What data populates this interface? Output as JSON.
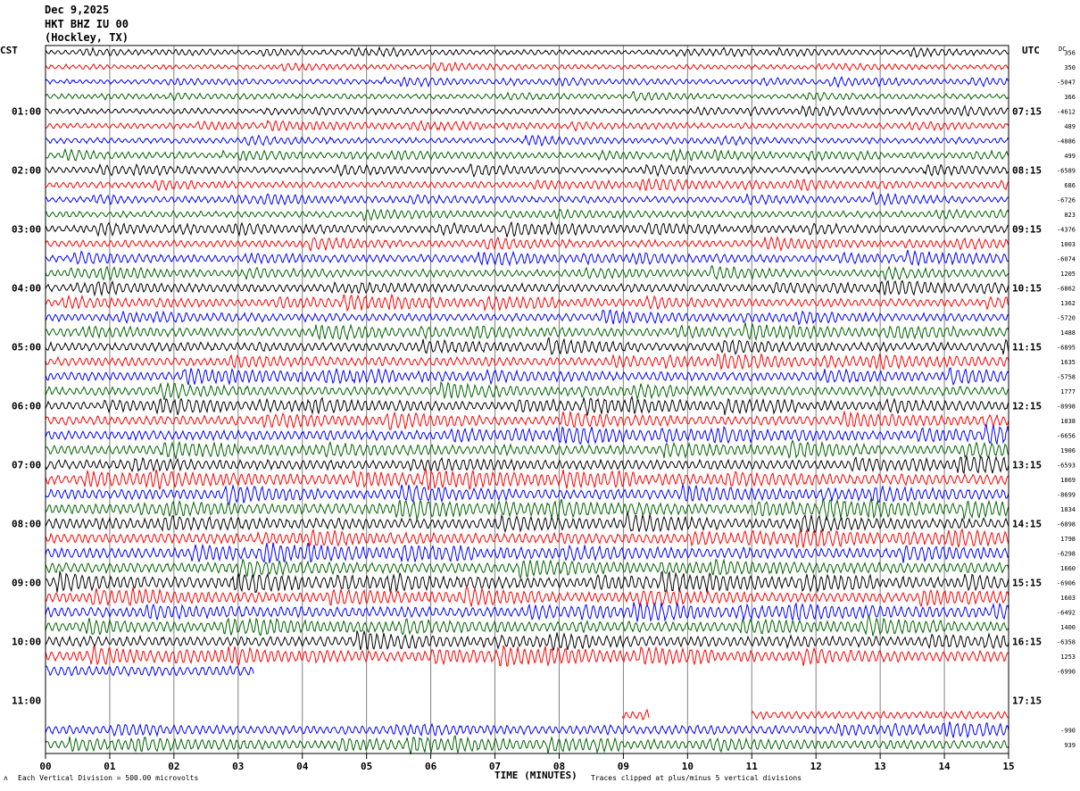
{
  "header": {
    "date": "Dec 9,2025",
    "station": "HKT BHZ IU 00",
    "location": "(Hockley, TX)"
  },
  "labels": {
    "left_tz": "CST",
    "right_tz": "UTC",
    "dc": "DC",
    "xlabel": "TIME (MINUTES)"
  },
  "footer": {
    "division": "Each Vertical Division =  500.00 microvolts",
    "clip": "Traces clipped at plus/minus 5 vertical divisions"
  },
  "colors": {
    "sequence": [
      "#000000",
      "#ff0000",
      "#0000ff",
      "#006400"
    ],
    "grid": "#808080"
  },
  "chart_data": {
    "type": "line",
    "title": "",
    "xlabel": "TIME (MINUTES)",
    "xlim": [
      0,
      15
    ],
    "x_ticks": [
      "00",
      "01",
      "02",
      "03",
      "04",
      "05",
      "06",
      "07",
      "08",
      "09",
      "10",
      "11",
      "12",
      "13",
      "14",
      "15"
    ],
    "minutes_per_trace": 15,
    "trace_count": 48,
    "left_hour_labels": [
      "01:00",
      "02:00",
      "03:00",
      "04:00",
      "05:00",
      "06:00",
      "07:00",
      "08:00",
      "09:00",
      "10:00",
      "11:00"
    ],
    "right_hour_labels": [
      "07:15",
      "08:15",
      "09:15",
      "10:15",
      "11:15",
      "12:15",
      "13:15",
      "14:15",
      "15:15",
      "16:15",
      "17:15"
    ],
    "dc_offsets": [
      "356",
      "350",
      "-5047",
      "366",
      "-4612",
      "489",
      "-4886",
      "499",
      "-6589",
      "686",
      "-6726",
      "823",
      "-4376",
      "1003",
      "-6074",
      "1205",
      "-6862",
      "1362",
      "-5720",
      "1488",
      "-6895",
      "1635",
      "-5758",
      "1777",
      "-8998",
      "1838",
      "-6656",
      "1906",
      "-6593",
      "1869",
      "-8699",
      "1834",
      "-6898",
      "1798",
      "-6298",
      "1660",
      "-6906",
      "1603",
      "-6492",
      "1400",
      "-6358",
      "1253",
      "-6990",
      "",
      "",
      "",
      "-990",
      "939"
    ],
    "traces": [
      {
        "index": 0,
        "color": "#000000",
        "amplitude": 0.6
      },
      {
        "index": 1,
        "color": "#ff0000",
        "amplitude": 0.6
      },
      {
        "index": 2,
        "color": "#0000ff",
        "amplitude": 0.6
      },
      {
        "index": 3,
        "color": "#006400",
        "amplitude": 0.6
      },
      {
        "index": 4,
        "color": "#000000",
        "amplitude": 0.7
      },
      {
        "index": 5,
        "color": "#ff0000",
        "amplitude": 0.7
      },
      {
        "index": 6,
        "color": "#0000ff",
        "amplitude": 0.7
      },
      {
        "index": 7,
        "color": "#006400",
        "amplitude": 0.7
      },
      {
        "index": 8,
        "color": "#000000",
        "amplitude": 0.8
      },
      {
        "index": 9,
        "color": "#ff0000",
        "amplitude": 0.8
      },
      {
        "index": 10,
        "color": "#0000ff",
        "amplitude": 0.8
      },
      {
        "index": 11,
        "color": "#006400",
        "amplitude": 0.8
      },
      {
        "index": 12,
        "color": "#000000",
        "amplitude": 0.9
      },
      {
        "index": 13,
        "color": "#ff0000",
        "amplitude": 0.9
      },
      {
        "index": 14,
        "color": "#0000ff",
        "amplitude": 0.9
      },
      {
        "index": 15,
        "color": "#006400",
        "amplitude": 0.9
      },
      {
        "index": 16,
        "color": "#000000",
        "amplitude": 1.0
      },
      {
        "index": 17,
        "color": "#ff0000",
        "amplitude": 1.0
      },
      {
        "index": 18,
        "color": "#0000ff",
        "amplitude": 1.0
      },
      {
        "index": 19,
        "color": "#006400",
        "amplitude": 1.0
      },
      {
        "index": 20,
        "color": "#000000",
        "amplitude": 1.1
      },
      {
        "index": 21,
        "color": "#ff0000",
        "amplitude": 1.1
      },
      {
        "index": 22,
        "color": "#0000ff",
        "amplitude": 1.1
      },
      {
        "index": 23,
        "color": "#006400",
        "amplitude": 1.1
      },
      {
        "index": 24,
        "color": "#000000",
        "amplitude": 1.1
      },
      {
        "index": 25,
        "color": "#ff0000",
        "amplitude": 1.2
      },
      {
        "index": 26,
        "color": "#0000ff",
        "amplitude": 1.2
      },
      {
        "index": 27,
        "color": "#006400",
        "amplitude": 1.2
      },
      {
        "index": 28,
        "color": "#000000",
        "amplitude": 1.2
      },
      {
        "index": 29,
        "color": "#ff0000",
        "amplitude": 1.3
      },
      {
        "index": 30,
        "color": "#0000ff",
        "amplitude": 1.3
      },
      {
        "index": 31,
        "color": "#006400",
        "amplitude": 1.3
      },
      {
        "index": 32,
        "color": "#000000",
        "amplitude": 1.3
      },
      {
        "index": 33,
        "color": "#ff0000",
        "amplitude": 1.3
      },
      {
        "index": 34,
        "color": "#0000ff",
        "amplitude": 1.3
      },
      {
        "index": 35,
        "color": "#006400",
        "amplitude": 1.3
      },
      {
        "index": 36,
        "color": "#000000",
        "amplitude": 1.3
      },
      {
        "index": 37,
        "color": "#ff0000",
        "amplitude": 1.3
      },
      {
        "index": 38,
        "color": "#0000ff",
        "amplitude": 1.3
      },
      {
        "index": 39,
        "color": "#006400",
        "amplitude": 1.3
      },
      {
        "index": 40,
        "color": "#000000",
        "amplitude": 1.3
      },
      {
        "index": 41,
        "color": "#ff0000",
        "amplitude": 1.3
      },
      {
        "index": 42,
        "color": "#0000ff",
        "amplitude": 1.3,
        "x_end": 3.25
      },
      {
        "index": 43,
        "color": "#006400",
        "amplitude": 0,
        "empty": true
      },
      {
        "index": 44,
        "color": "#000000",
        "amplitude": 0,
        "empty": true
      },
      {
        "index": 45,
        "color": "#ff0000",
        "amplitude": 1.0,
        "segments": [
          [
            8.98,
            9.4
          ],
          [
            11.0,
            15.0
          ]
        ]
      },
      {
        "index": 46,
        "color": "#0000ff",
        "amplitude": 1.1
      },
      {
        "index": 47,
        "color": "#006400",
        "amplitude": 1.1
      }
    ]
  }
}
